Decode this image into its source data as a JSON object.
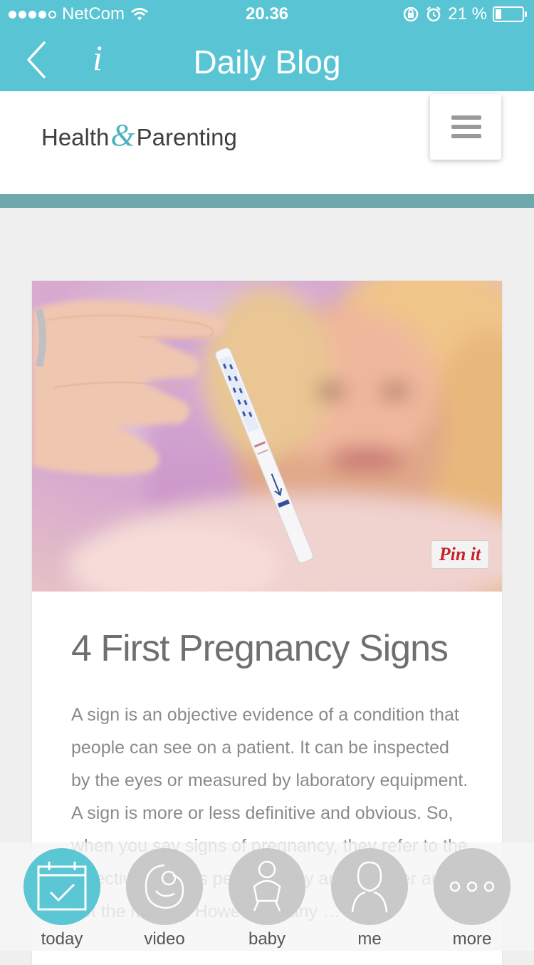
{
  "status_bar": {
    "carrier": "NetCom",
    "time": "20.36",
    "battery_percent": "21 %",
    "battery_level": 0.21,
    "signal_bars_filled": 4
  },
  "nav": {
    "back_icon": "chevron-left-icon",
    "info_label": "i",
    "title": "Daily Blog"
  },
  "site": {
    "logo_left": "Health",
    "logo_amp": "&",
    "logo_right": "Parenting",
    "menu_icon": "hamburger-icon"
  },
  "article": {
    "pin_label": "Pin it",
    "title": "4 First Pregnancy Signs",
    "excerpt": "A sign is an objective evidence of a condition that people can see on a patient. It can be inspected by the eyes or measured by laboratory equipment. A sign is more or less definitive and obvious. So, when you say signs of pregnancy, they refer to the objective findings perceived by an examiner and not the mother. However, many …"
  },
  "tabs": [
    {
      "label": "today",
      "icon": "calendar-check-icon",
      "active": true
    },
    {
      "label": "video",
      "icon": "fetus-icon",
      "active": false
    },
    {
      "label": "baby",
      "icon": "baby-icon",
      "active": false
    },
    {
      "label": "me",
      "icon": "person-icon",
      "active": false
    },
    {
      "label": "more",
      "icon": "more-dots-icon",
      "active": false
    }
  ],
  "colors": {
    "accent": "#59c4d3",
    "divider": "#6ea9ae",
    "pinterest": "#c8232c"
  }
}
